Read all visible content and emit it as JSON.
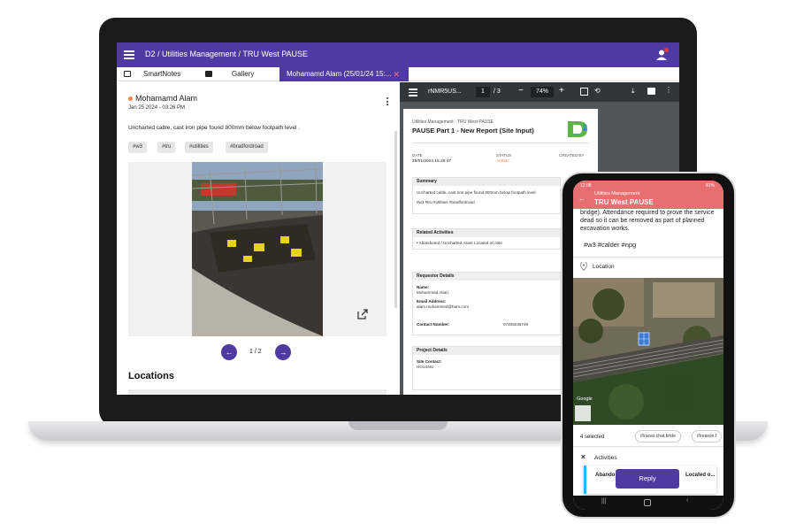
{
  "laptop": {
    "header": {
      "title": "D2 / Utilities Management / TRU West PAUSE"
    },
    "tabs": [
      {
        "label": "SmartNotes"
      },
      {
        "label": "Gallery"
      },
      {
        "label": "Mohamamd  Alam (25/01/24 15:..."
      }
    ],
    "note": {
      "author": "Mohamamd  Alam",
      "date": "Jan 25 2024 - 03:26 PM",
      "text": "Uncharted cable, cast iron pipe  found 800mm below footpath level .",
      "tags": [
        "#w3",
        "#tru",
        "#utilities",
        "#bradfordroad"
      ],
      "pager": "1 / 2",
      "locations_title": "Locations"
    },
    "pdf": {
      "filename": "rNMR5US...",
      "page_current": "1",
      "page_total": "/ 3",
      "zoom": "74%",
      "doc_subtitle": "Utilities Management - TRU West PAUSE",
      "doc_title": "PAUSE Part 1 - New Report (Site Input)",
      "date_label": "DATE",
      "date_value": "25/01/2024 15:26:47",
      "status_label": "STATUS",
      "status_value": "Amber",
      "created_label": "CREATED BY",
      "summary_title": "Summary",
      "summary_text": "Uncharted cable, cast iron pipe found 800mm below footpath level",
      "summary_tags": "#w3 #tru #utilities #bradfordroad",
      "related_title": "Related Activities",
      "related_item": "Abandoned / Uncharted Asset Located on Site",
      "requestor_title": "Requestor Details",
      "name_label": "Name:",
      "name_value": "Mohammad Alam",
      "email_label": "Email Address:",
      "email_value": "alam.mohammed@bam.com",
      "contact_label": "Contact Number:",
      "contact_value": "07405035746",
      "project_title": "Project Details",
      "site_contact_label": "Site Contact:",
      "site_contact_value": "HO1SNU"
    }
  },
  "phone": {
    "status_time": "12:08",
    "status_battery": "81%",
    "subtitle": "Utilities Management",
    "title": "TRU West PAUSE",
    "body_text": "bridge). Attendance required to prove the service dead so it can be removed as part of planned excavation works.",
    "tags": "#w3 #calder #npg",
    "location_label": "Location",
    "map_attrib": "Google",
    "selected": "4 selected",
    "chips": [
      "///races.chat.bride",
      "///reason.f"
    ],
    "activities_label": "Activities",
    "card_text_left": "Abando",
    "card_text_right": "Located o...",
    "reply_label": "Reply"
  },
  "colors": {
    "brand_purple": "#4e3aa0",
    "phone_header": "#e86f6f",
    "status_amber": "#f08a4b"
  }
}
